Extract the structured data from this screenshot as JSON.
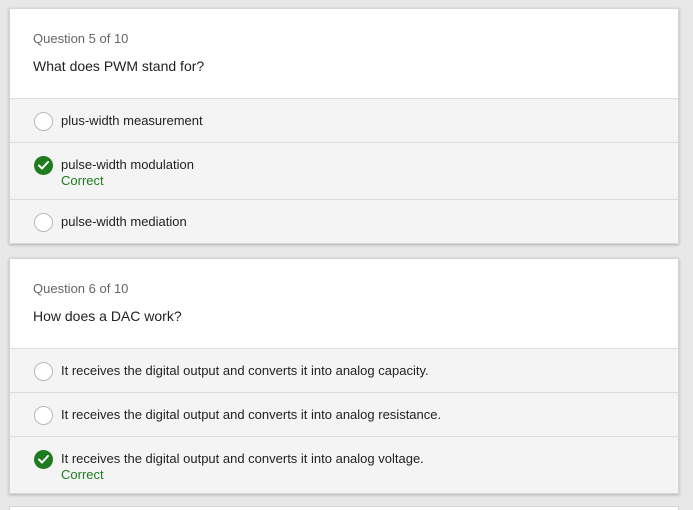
{
  "questions": [
    {
      "number": "Question 5 of 10",
      "text": "What does PWM stand for?",
      "options": [
        {
          "label": "plus-width measurement",
          "selected": false,
          "feedback": ""
        },
        {
          "label": "pulse-width modulation",
          "selected": true,
          "feedback": "Correct"
        },
        {
          "label": "pulse-width mediation",
          "selected": false,
          "feedback": ""
        }
      ]
    },
    {
      "number": "Question 6 of 10",
      "text": "How does a DAC work?",
      "options": [
        {
          "label": "It receives the digital output and converts it into analog capacity.",
          "selected": false,
          "feedback": ""
        },
        {
          "label": "It receives the digital output and converts it into analog resistance.",
          "selected": false,
          "feedback": ""
        },
        {
          "label": "It receives the digital output and converts it into analog voltage.",
          "selected": true,
          "feedback": "Correct"
        }
      ]
    }
  ],
  "colors": {
    "correct": "#1e7b1e",
    "option_bg": "#f4f4f4",
    "page_bg": "#e8e8e8"
  }
}
